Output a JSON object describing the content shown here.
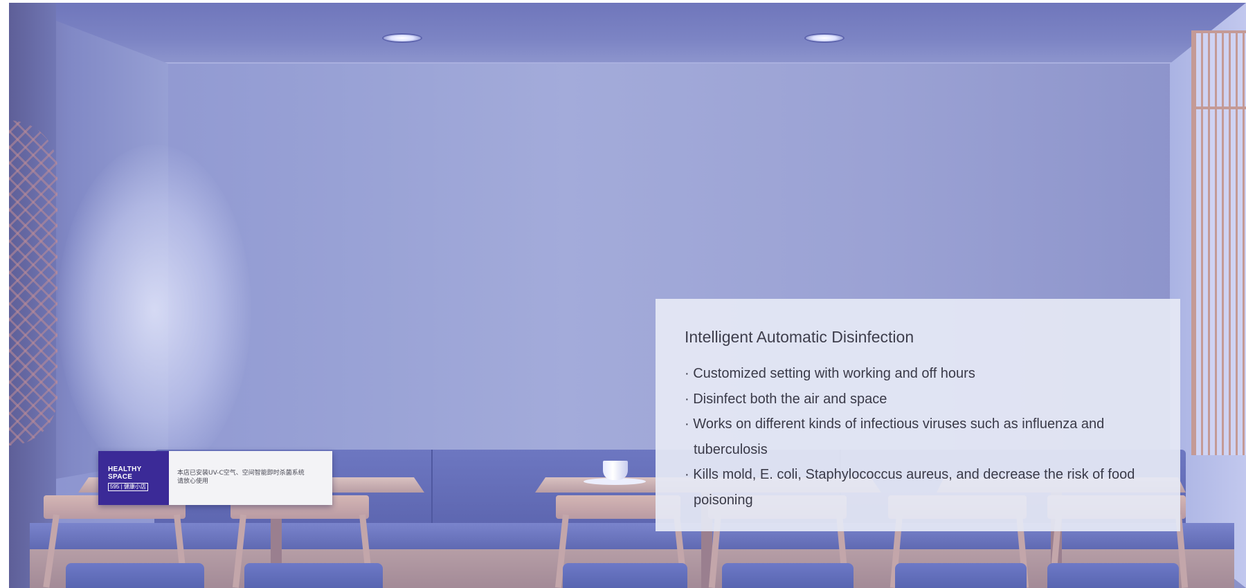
{
  "sign": {
    "logo_line1": "HEALTHY",
    "logo_line2": "SPACE",
    "logo_line3": "595 | 健康小店",
    "text_line1": "本店已安装UV-C空气、空间智能即时杀菌系统",
    "text_line2": "请放心使用"
  },
  "info": {
    "title": "Intelligent Automatic Disinfection",
    "bullets": [
      "· Customized setting with working and off hours",
      "· Disinfect both the air and space",
      "· Works on different kinds of infectious viruses such as influenza and tuberculosis",
      "· Kills mold, E. coli, Staphylococcus aureus, and decrease the risk of food poisoning"
    ]
  },
  "colors": {
    "room": "#9aa3d6",
    "sign_brand": "#3b2a97",
    "card_bg": "#e6e9f5",
    "wood": "#c3a6aa"
  }
}
